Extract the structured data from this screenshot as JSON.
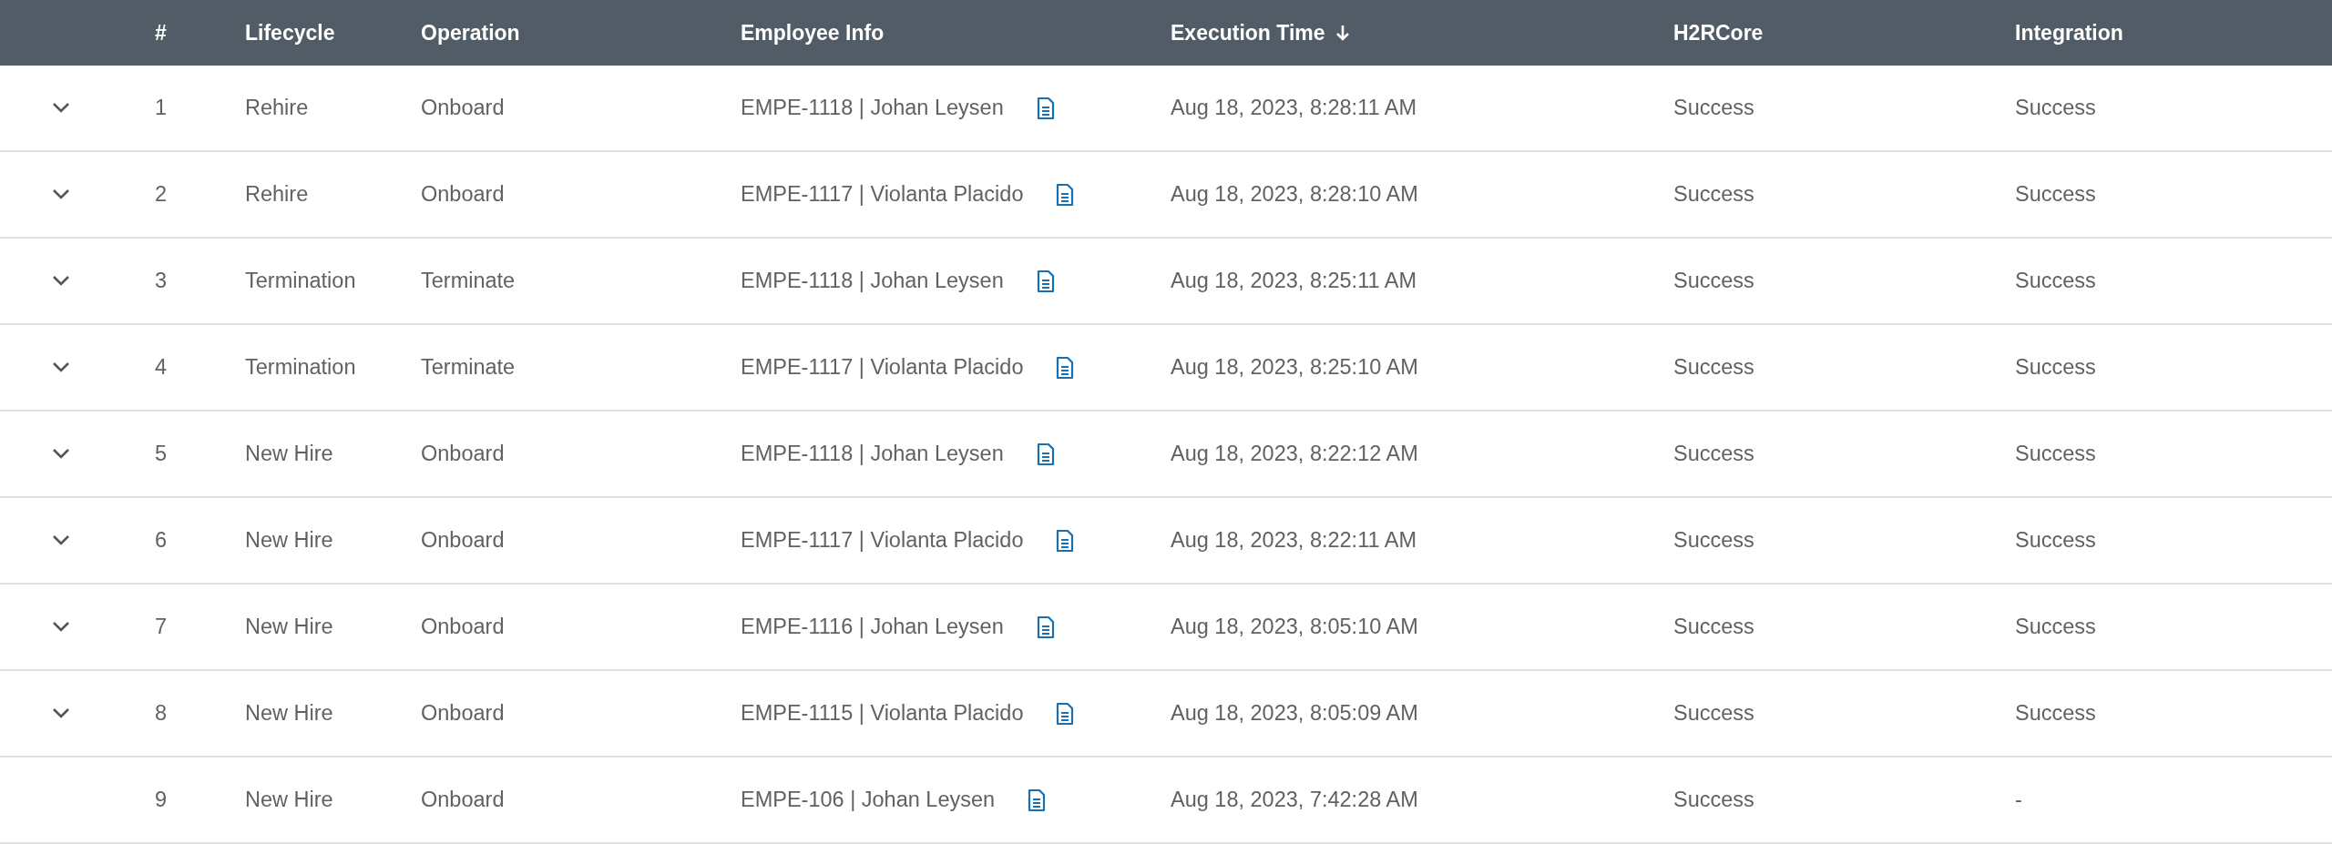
{
  "table": {
    "columns": [
      {
        "label": "#",
        "sorted": false
      },
      {
        "label": "Lifecycle",
        "sorted": false
      },
      {
        "label": "Operation",
        "sorted": false
      },
      {
        "label": "Employee Info",
        "sorted": false
      },
      {
        "label": "Execution Time",
        "sorted": true
      },
      {
        "label": "H2RCore",
        "sorted": false
      },
      {
        "label": "Integration",
        "sorted": false
      }
    ],
    "rows": [
      {
        "expandable": true,
        "number": "1",
        "lifecycle": "Rehire",
        "operation": "Onboard",
        "employee": "EMPE-1118 | Johan Leysen",
        "time": "Aug 18, 2023, 8:28:11 AM",
        "h2rcore": "Success",
        "integration": "Success"
      },
      {
        "expandable": true,
        "number": "2",
        "lifecycle": "Rehire",
        "operation": "Onboard",
        "employee": "EMPE-1117 | Violanta Placido",
        "time": "Aug 18, 2023, 8:28:10 AM",
        "h2rcore": "Success",
        "integration": "Success"
      },
      {
        "expandable": true,
        "number": "3",
        "lifecycle": "Termination",
        "operation": "Terminate",
        "employee": "EMPE-1118 | Johan Leysen",
        "time": "Aug 18, 2023, 8:25:11 AM",
        "h2rcore": "Success",
        "integration": "Success"
      },
      {
        "expandable": true,
        "number": "4",
        "lifecycle": "Termination",
        "operation": "Terminate",
        "employee": "EMPE-1117 | Violanta Placido",
        "time": "Aug 18, 2023, 8:25:10 AM",
        "h2rcore": "Success",
        "integration": "Success"
      },
      {
        "expandable": true,
        "number": "5",
        "lifecycle": "New Hire",
        "operation": "Onboard",
        "employee": "EMPE-1118 | Johan Leysen",
        "time": "Aug 18, 2023, 8:22:12 AM",
        "h2rcore": "Success",
        "integration": "Success"
      },
      {
        "expandable": true,
        "number": "6",
        "lifecycle": "New Hire",
        "operation": "Onboard",
        "employee": "EMPE-1117 | Violanta Placido",
        "time": "Aug 18, 2023, 8:22:11 AM",
        "h2rcore": "Success",
        "integration": "Success"
      },
      {
        "expandable": true,
        "number": "7",
        "lifecycle": "New Hire",
        "operation": "Onboard",
        "employee": "EMPE-1116 | Johan Leysen",
        "time": "Aug 18, 2023, 8:05:10 AM",
        "h2rcore": "Success",
        "integration": "Success"
      },
      {
        "expandable": true,
        "number": "8",
        "lifecycle": "New Hire",
        "operation": "Onboard",
        "employee": "EMPE-1115 | Violanta Placido",
        "time": "Aug 18, 2023, 8:05:09 AM",
        "h2rcore": "Success",
        "integration": "Success"
      },
      {
        "expandable": false,
        "number": "9",
        "lifecycle": "New Hire",
        "operation": "Onboard",
        "employee": "EMPE-106 | Johan Leysen",
        "time": "Aug 18, 2023, 7:42:28 AM",
        "h2rcore": "Success",
        "integration": "-"
      }
    ]
  }
}
